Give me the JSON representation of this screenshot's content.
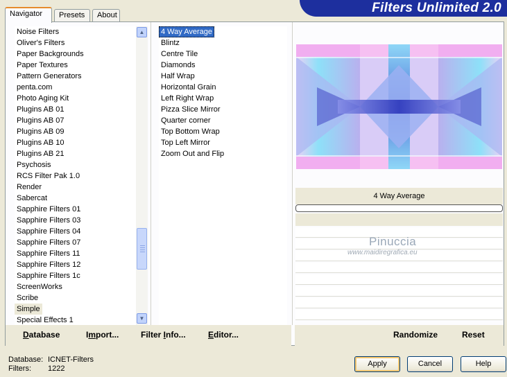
{
  "tabs": [
    "Navigator",
    "Presets",
    "About"
  ],
  "banner_title": "Filters Unlimited 2.0",
  "categories": [
    "Noise Filters",
    "Oliver's Filters",
    "Paper Backgrounds",
    "Paper Textures",
    "Pattern Generators",
    "penta.com",
    "Photo Aging Kit",
    "Plugins AB 01",
    "Plugins AB 07",
    "Plugins AB 09",
    "Plugins AB 10",
    "Plugins AB 21",
    "Psychosis",
    "RCS Filter Pak 1.0",
    "Render",
    "Sabercat",
    "Sapphire Filters 01",
    "Sapphire Filters 03",
    "Sapphire Filters 04",
    "Sapphire Filters 07",
    "Sapphire Filters 11",
    "Sapphire Filters 12",
    "Sapphire Filters 1c",
    "ScreenWorks",
    "Scribe",
    "Simple",
    "Special Effects 1"
  ],
  "selected_category": "Simple",
  "filters": [
    "4 Way Average",
    "Blintz",
    "Centre Tile",
    "Diamonds",
    "Half Wrap",
    "Horizontal Grain",
    "Left Right Wrap",
    "Pizza Slice Mirror",
    "Quarter corner",
    "Top Bottom Wrap",
    "Top Left Mirror",
    "Zoom Out and Flip"
  ],
  "selected_filter": "4 Way Average",
  "preview": {
    "filter_name": "4 Way Average",
    "watermark_name": "Pinuccia",
    "watermark_url": "www.maidiregrafica.eu"
  },
  "toolbar": {
    "database": {
      "u": "D",
      "rest": "atabase"
    },
    "import": {
      "a": "I",
      "u": "m",
      "rest": "port..."
    },
    "filter_info": {
      "a": "Filter ",
      "u": "I",
      "rest": "nfo..."
    },
    "editor": {
      "u": "E",
      "rest": "ditor..."
    },
    "randomize": "Randomize",
    "reset": "Reset"
  },
  "status": {
    "database_label": "Database:",
    "database_value": "ICNET-Filters",
    "filters_label": "Filters:",
    "filters_value": "1222"
  },
  "buttons": {
    "apply": "Apply",
    "cancel": "Cancel",
    "help": "Help"
  },
  "colors": {
    "selection": "#316ac5",
    "banner": "#1d2f9e",
    "active_tab_accent": "#e68b2c",
    "window_bg": "#ece9d8"
  }
}
